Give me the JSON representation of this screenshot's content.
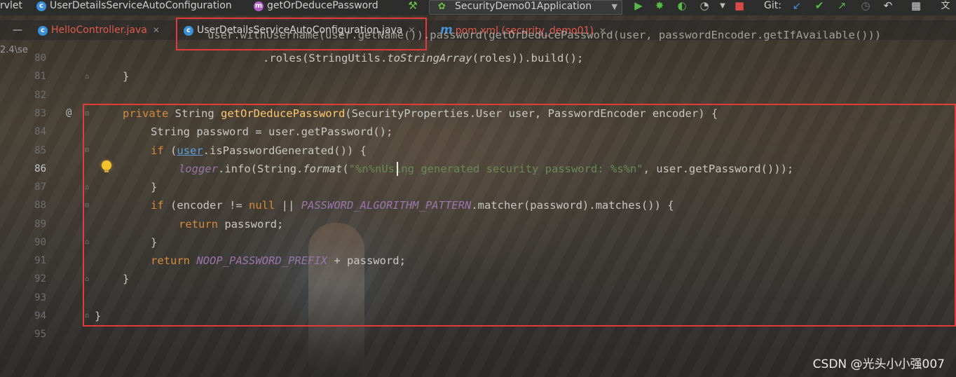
{
  "toolbar": {
    "breadcrumb_servlet": "rvlet",
    "breadcrumb_class": "UserDetailsServiceAutoConfiguration",
    "breadcrumb_method": "getOrDeducePassword",
    "run_config": "SecurityDemo01Application",
    "git_label": "Git:"
  },
  "tabs": [
    {
      "label": "HelloController.java",
      "badge": "c",
      "color": "#e05b4e"
    },
    {
      "label": "UserDetailsServiceAutoConfiguration.java",
      "badge": "c",
      "color": "#cfcfcf",
      "active": true
    },
    {
      "label": "pom.xml (security_demo01)",
      "badge": "m",
      "color": "#e05b4e"
    }
  ],
  "side_note": "2.4\\se",
  "line_numbers": [
    "80",
    "81",
    "82",
    "83",
    "84",
    "85",
    "86",
    "87",
    "88",
    "89",
    "90",
    "91",
    "92",
    "93",
    "94",
    "95"
  ],
  "current_line": "86",
  "code": {
    "l79a": "user.withUsername(user.getName()).password(getOrDeducePassword(user, passwordEncoder.getIfAvailable()))",
    "l80_a": ".roles(StringUtils.",
    "l80_b": "toStringArray",
    "l80_c": "(roles)).build();",
    "l81": "}",
    "l83_kw": "private",
    "l83_type": " String ",
    "l83_fn": "getOrDeducePassword",
    "l83_rest": "(SecurityProperties.User user, PasswordEncoder encoder) {",
    "l84": "String password = user.getPassword();",
    "l85_kw": "if",
    "l85_a": " (",
    "l85_user": "user",
    "l85_b": ".isPasswordGenerated()) {",
    "l86_logger": "logger",
    "l86_a": ".info(String.",
    "l86_fmt": "format",
    "l86_b": "(",
    "l86_str": "\"%n%nUsing generated security password: %s%n\"",
    "l86_c": ", user.getPassword()));",
    "l87": "}",
    "l88_kw": "if",
    "l88_a": " (encoder != ",
    "l88_null": "null",
    "l88_b": " || ",
    "l88_const": "PASSWORD_ALGORITHM_PATTERN",
    "l88_c": ".matcher(password).matches()) {",
    "l89_kw": "return",
    "l89_a": " password;",
    "l90": "}",
    "l91_kw": "return",
    "l91_const": "NOOP_PASSWORD_PREFIX",
    "l91_a": " + password;",
    "l92": "}",
    "l94": "}"
  },
  "annotation_marker": "@",
  "watermark": "CSDN @光头小小强007",
  "highlight_color": "#e33b3b"
}
